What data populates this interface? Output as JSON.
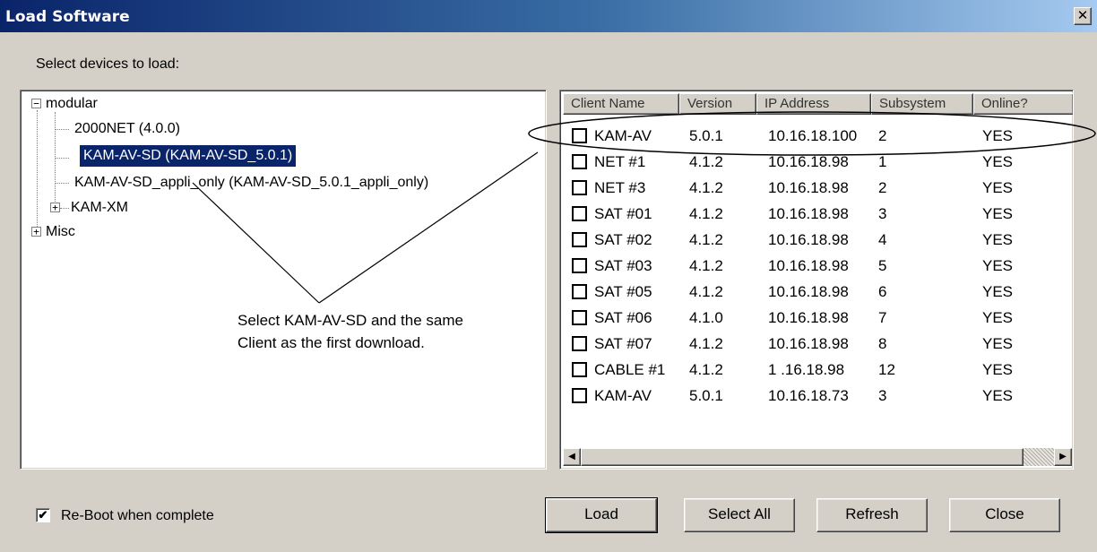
{
  "window": {
    "title": "Load Software",
    "close_glyph": "✕"
  },
  "prompt": "Select devices to load:",
  "tree": {
    "root": "modular",
    "children": [
      "2000NET (4.0.0)",
      "KAM-AV-SD  (KAM-AV-SD_5.0.1)",
      "KAM-AV-SD_appli_only  (KAM-AV-SD_5.0.1_appli_only)",
      "KAM-XM"
    ],
    "misc": "Misc",
    "expand_glyph": "+",
    "collapse_glyph": "−"
  },
  "list": {
    "headers": [
      "Client Name",
      "Version",
      "IP Address",
      "Subsystem",
      "Online?"
    ],
    "rows": [
      [
        "KAM-AV",
        "5.0.1",
        "10.16.18.100",
        "2",
        "YES"
      ],
      [
        "NET #1",
        "4.1.2",
        "10.16.18.98",
        "1",
        "YES"
      ],
      [
        "NET #3",
        "4.1.2",
        "10.16.18.98",
        "2",
        "YES"
      ],
      [
        "SAT #01",
        "4.1.2",
        "10.16.18.98",
        "3",
        "YES"
      ],
      [
        "SAT #02",
        "4.1.2",
        "10.16.18.98",
        "4",
        "YES"
      ],
      [
        "SAT #03",
        "4.1.2",
        "10.16.18.98",
        "5",
        "YES"
      ],
      [
        "SAT #05",
        "4.1.2",
        "10.16.18.98",
        "6",
        "YES"
      ],
      [
        "SAT #06",
        "4.1.0",
        "10.16.18.98",
        "7",
        "YES"
      ],
      [
        "SAT #07",
        "4.1.2",
        "10.16.18.98",
        "8",
        "YES"
      ],
      [
        "CABLE #1",
        "4.1.2",
        "1 .16.18.98",
        "12",
        "YES"
      ],
      [
        "KAM-AV",
        "5.0.1",
        "10.16.18.73",
        "3",
        "YES"
      ]
    ],
    "scroll_left_glyph": "◀",
    "scroll_right_glyph": "▶"
  },
  "annotation": {
    "line1": "Select KAM-AV-SD and the same",
    "line2": "Client as the first download."
  },
  "reboot": {
    "label": "Re-Boot when complete",
    "checked": true,
    "glyph": "✔"
  },
  "buttons": {
    "load": "Load",
    "select_all": "Select All",
    "refresh": "Refresh",
    "close": "Close"
  }
}
